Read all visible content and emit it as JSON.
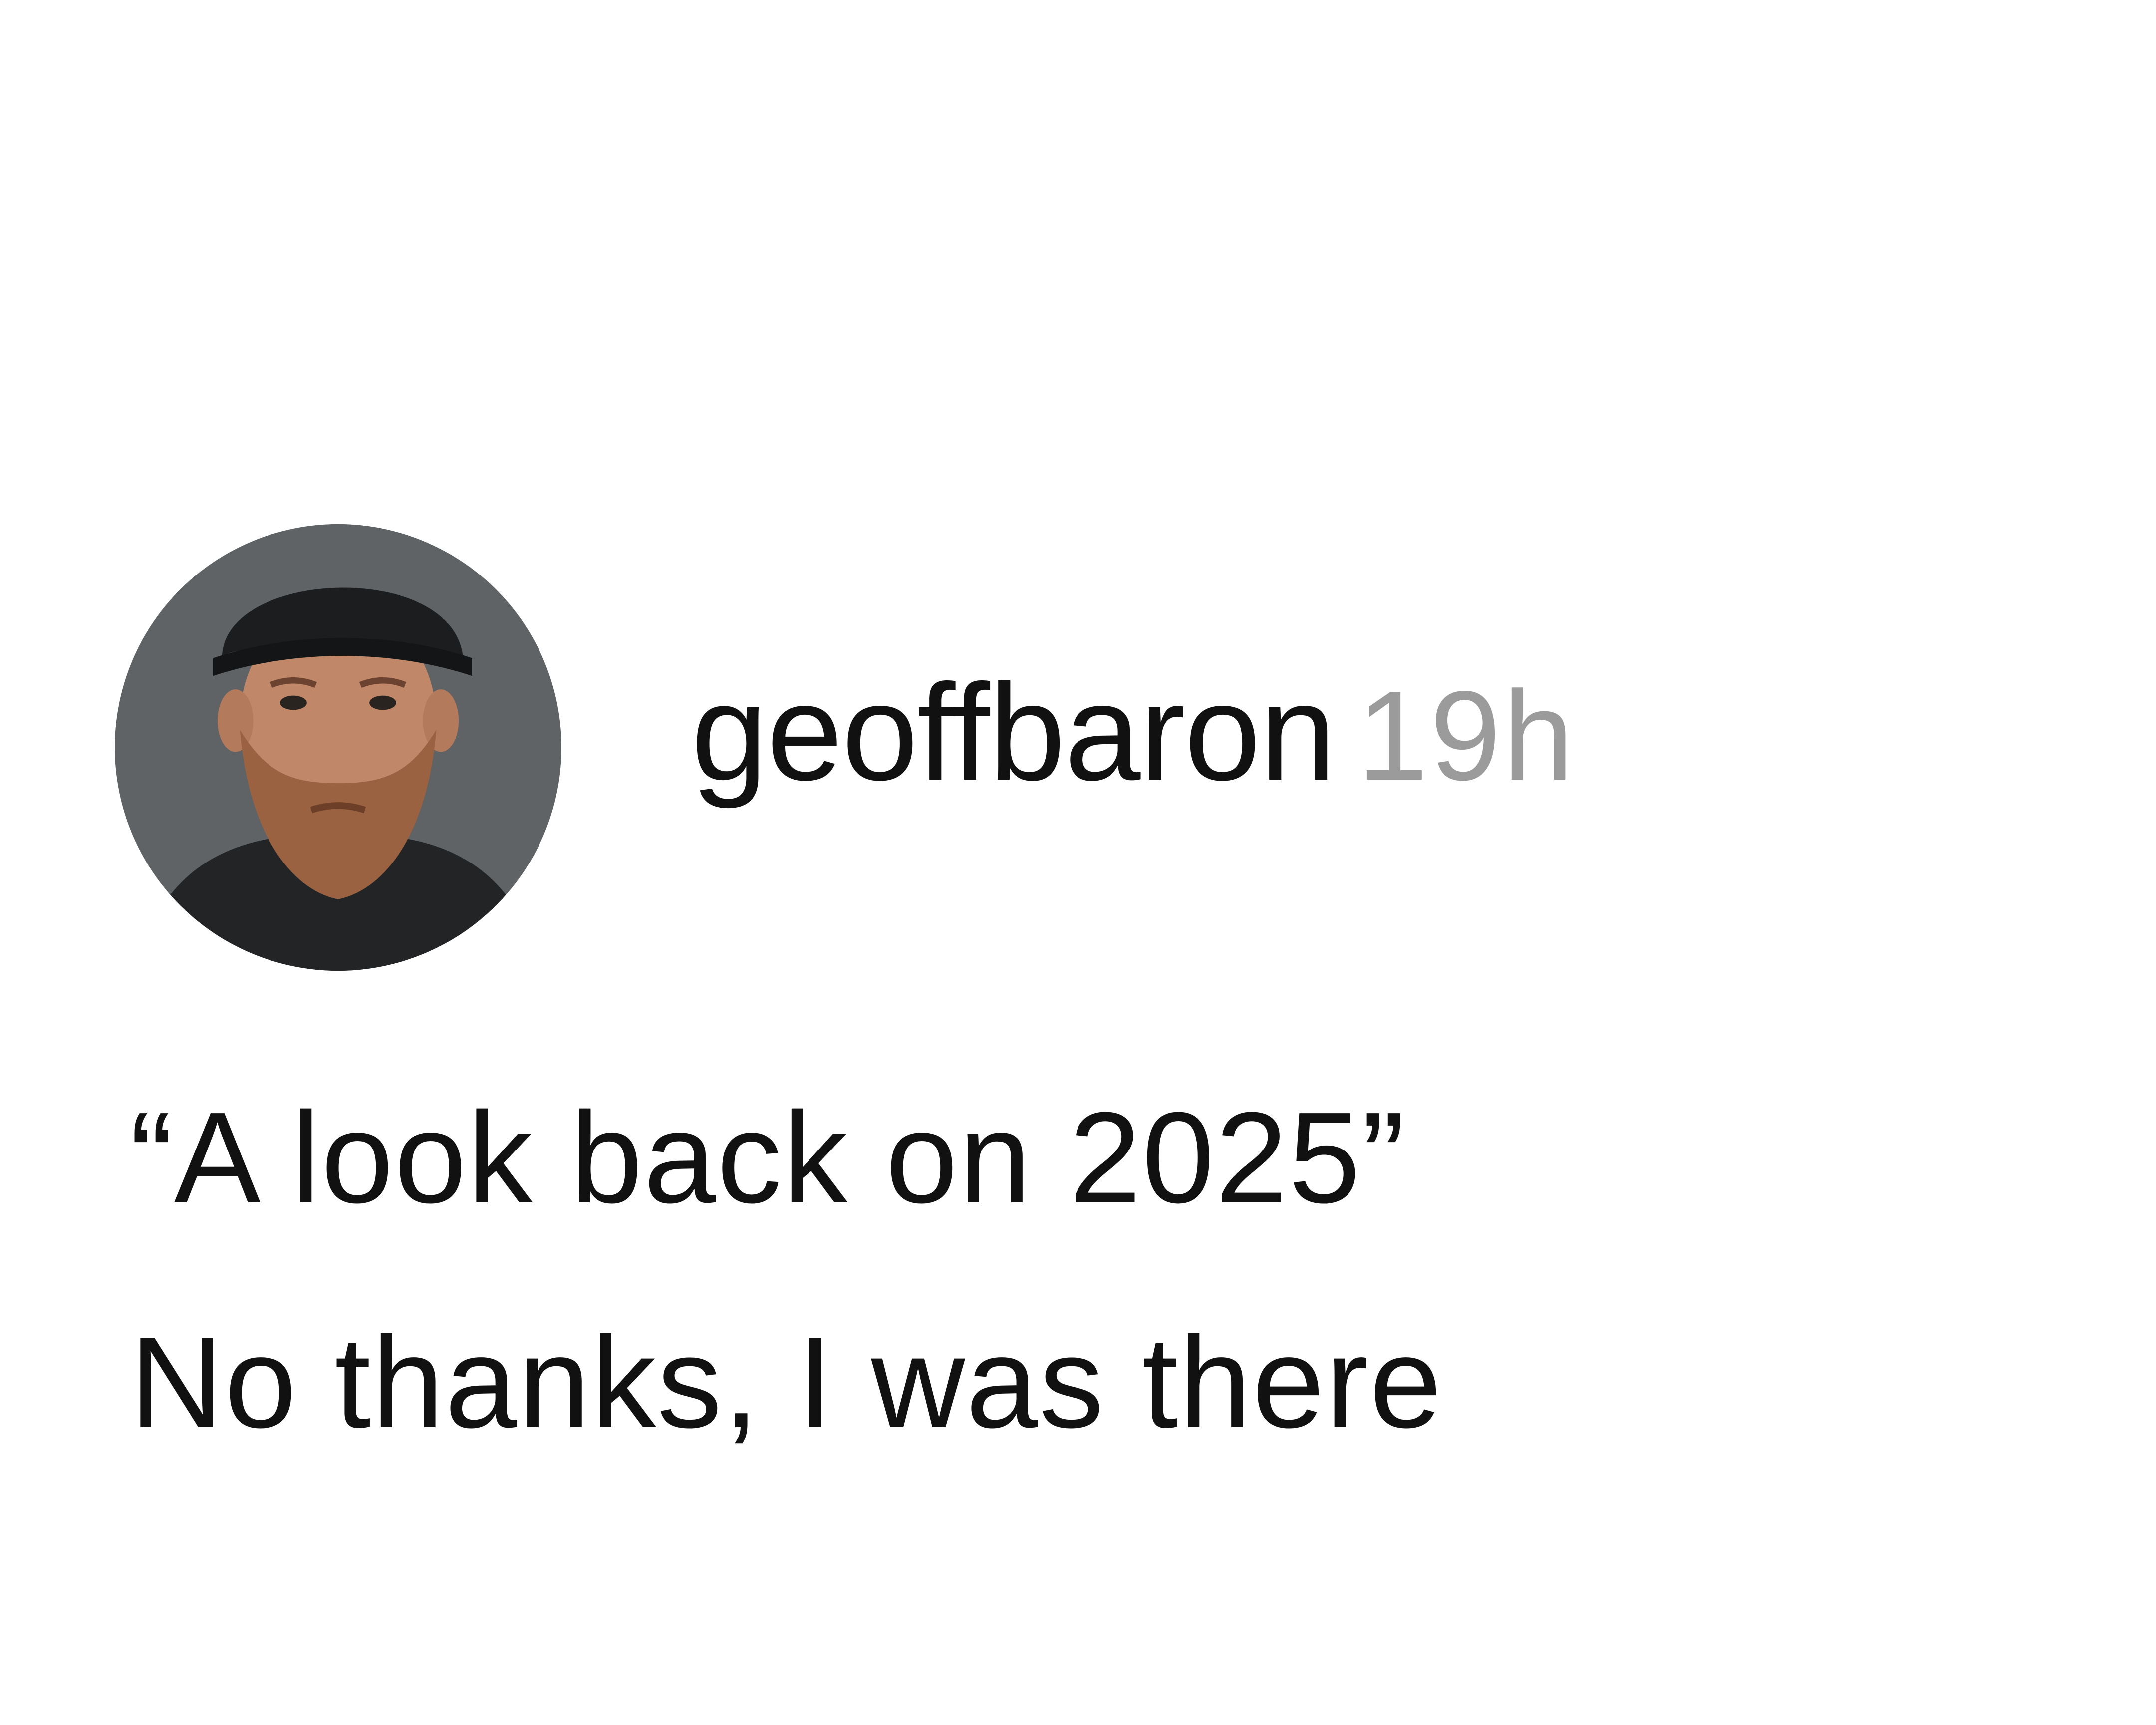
{
  "post": {
    "username": "geoffbaron",
    "timestamp": "19h",
    "avatar_icon": "profile-photo-avatar",
    "caption_lines": [
      "“A look back on 2025”",
      "No thanks, I was there"
    ]
  },
  "colors": {
    "background": "#ffffff",
    "text": "#111111",
    "timestamp": "#9b9b9b"
  }
}
